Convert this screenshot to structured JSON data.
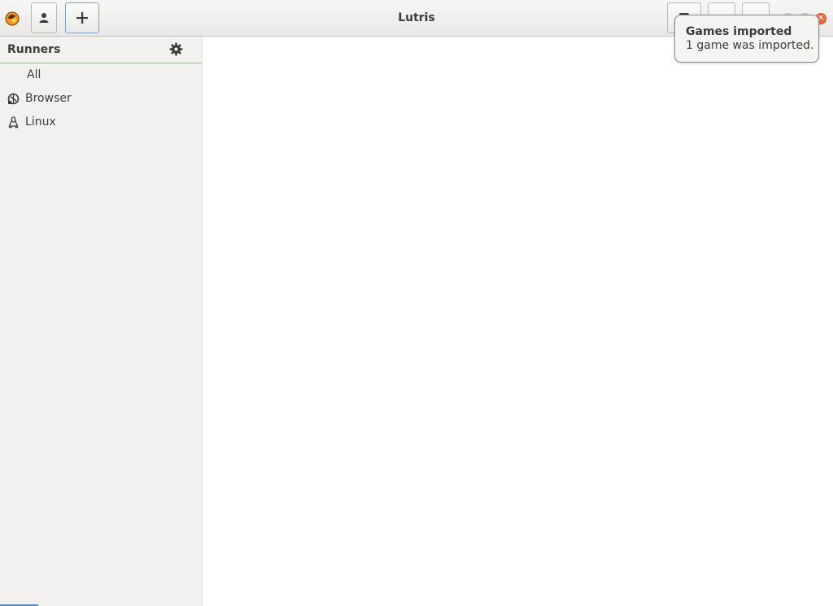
{
  "window": {
    "title": "Lutris"
  },
  "headerbar": {
    "buttons": [
      {
        "icon": "user-icon"
      },
      {
        "icon": "plus-icon"
      }
    ]
  },
  "sidebar": {
    "title": "Runners",
    "items": [
      {
        "label": "All",
        "icon": ""
      },
      {
        "label": "Browser",
        "icon": "browser-icon"
      },
      {
        "label": "Linux",
        "icon": "linux-icon"
      }
    ]
  },
  "notification": {
    "title": "Games imported",
    "body": "1 game was imported."
  },
  "colors": {
    "accent": "#4a90d9",
    "close": "#f0683a",
    "logo": "#f39c12"
  }
}
